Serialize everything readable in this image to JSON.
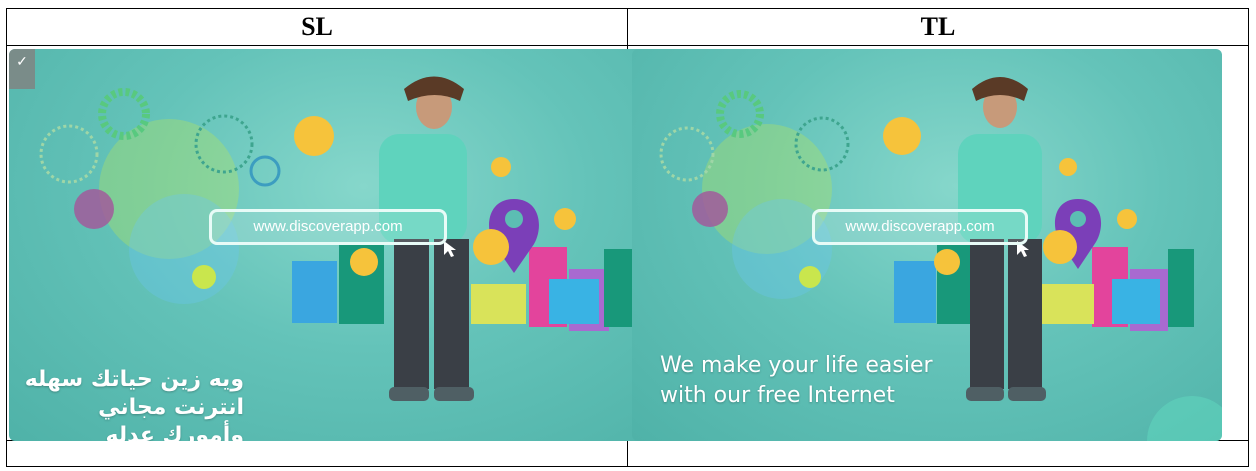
{
  "table": {
    "headers": [
      "SL",
      "TL"
    ]
  },
  "ads": {
    "left": {
      "url": "www.discoverapp.com",
      "tagline_lines": [
        "ويه زين حياتك سهله",
        "انترنت مجاني وأمورك عدله"
      ]
    },
    "right": {
      "url": "www.discoverapp.com",
      "tagline_lines": [
        "We make your life easier",
        "with our free Internet"
      ]
    }
  },
  "colors": {
    "background_teal": "#5cbdb3",
    "person_shirt": "#5fd3bd",
    "jeans": "#3a3f46",
    "map_pin": "#7b3fb8",
    "building_pink": "#e3449c",
    "building_blue": "#3aa6e0",
    "building_yellow": "#d9e35a",
    "building_teal": "#18987a"
  },
  "icons": [
    "heart-eyes-emoji-icon",
    "grinning-emoji-icon",
    "surprised-emoji-icon",
    "location-pin-icon",
    "cursor-icon",
    "gear-decoration-icon"
  ]
}
